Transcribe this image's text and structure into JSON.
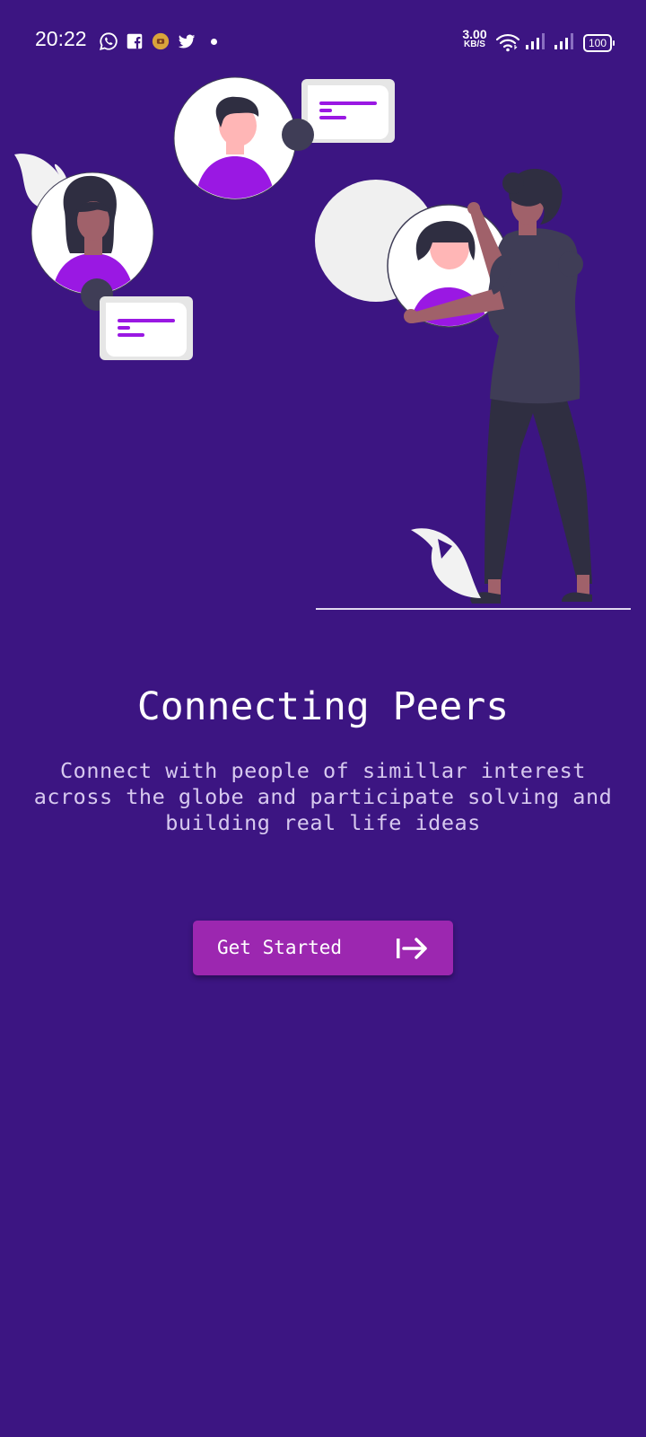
{
  "status_bar": {
    "time": "20:22",
    "notification_icons": [
      "whatsapp-icon",
      "facebook-icon",
      "app-icon",
      "twitter-icon",
      "dot-icon"
    ],
    "net_speed_value": "3.00",
    "net_speed_unit": "KB/S",
    "system_icons": [
      "wifi-icon",
      "signal-1-icon",
      "signal-2-icon"
    ],
    "battery": "100"
  },
  "illustration": {
    "name": "connecting-people-illustration"
  },
  "onboarding": {
    "title": "Connecting Peers",
    "description": "Connect with people of simillar interest across the globe and participate solving and building real life ideas",
    "button_label": "Get Started",
    "button_icon": "arrow-right-to-bar-icon"
  },
  "colors": {
    "background": "#3c1582",
    "button": "#9c27b0",
    "accent": "#9a18e3",
    "figure_dark": "#2f2e41",
    "skin": "#a0616a"
  }
}
